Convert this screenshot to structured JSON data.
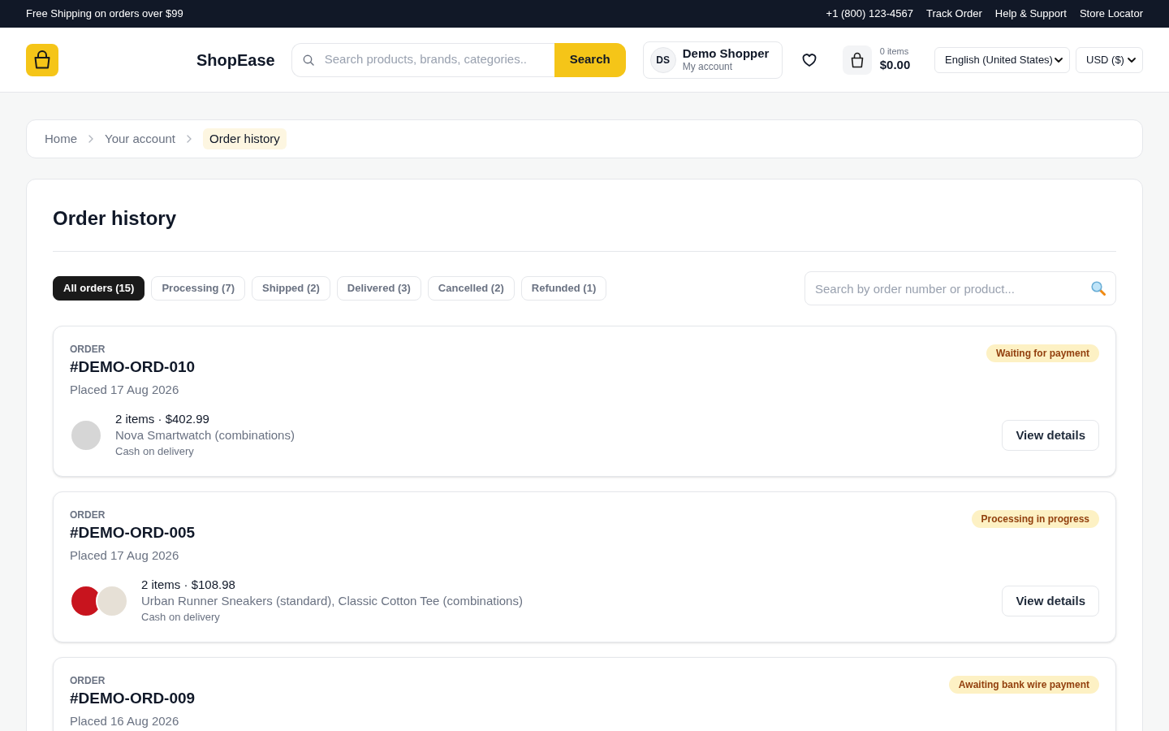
{
  "top_bar": {
    "promo": "Free Shipping on orders over $99",
    "links": [
      "+1 (800) 123-4567",
      "Track Order",
      "Help & Support",
      "Store Locator"
    ]
  },
  "header": {
    "brand": "ShopEase",
    "search": {
      "placeholder": "Search products, brands, categories..",
      "button": "Search"
    },
    "account": {
      "initials": "DS",
      "name": "Demo Shopper",
      "subtitle": "My account"
    },
    "cart": {
      "count": "0 items",
      "total": "$0.00"
    },
    "language": "English (United States)",
    "currency": "USD ($)"
  },
  "breadcrumbs": [
    {
      "label": "Home",
      "current": false
    },
    {
      "label": "Your account",
      "current": false
    },
    {
      "label": "Order history",
      "current": true
    }
  ],
  "page": {
    "title": "Order history",
    "filters": [
      {
        "label": "All orders (15)",
        "selected": true
      },
      {
        "label": "Processing (7)",
        "selected": false
      },
      {
        "label": "Shipped (2)",
        "selected": false
      },
      {
        "label": "Delivered (3)",
        "selected": false
      },
      {
        "label": "Cancelled (2)",
        "selected": false
      },
      {
        "label": "Refunded (1)",
        "selected": false
      }
    ],
    "order_search": {
      "placeholder": "Search by order number or product..."
    },
    "orders": [
      {
        "label": "ORDER",
        "number": "#DEMO-ORD-010",
        "placed": "Placed 17 Aug 2026",
        "status": "Waiting for payment",
        "thumbnails": [
          {
            "color": "#d6d6d6"
          }
        ],
        "summary": "2 items · $402.99",
        "products": "Nova Smartwatch (combinations)",
        "payment": "Cash on delivery",
        "button": "View details"
      },
      {
        "label": "ORDER",
        "number": "#DEMO-ORD-005",
        "placed": "Placed 17 Aug 2026",
        "status": "Processing in progress",
        "thumbnails": [
          {
            "color": "#c8141e"
          },
          {
            "color": "#e6e0d6"
          }
        ],
        "summary": "2 items · $108.98",
        "products": "Urban Runner Sneakers (standard), Classic Cotton Tee (combinations)",
        "payment": "Cash on delivery",
        "button": "View details"
      },
      {
        "label": "ORDER",
        "number": "#DEMO-ORD-009",
        "placed": "Placed 16 Aug 2026",
        "status": "Awaiting bank wire payment"
      }
    ]
  }
}
